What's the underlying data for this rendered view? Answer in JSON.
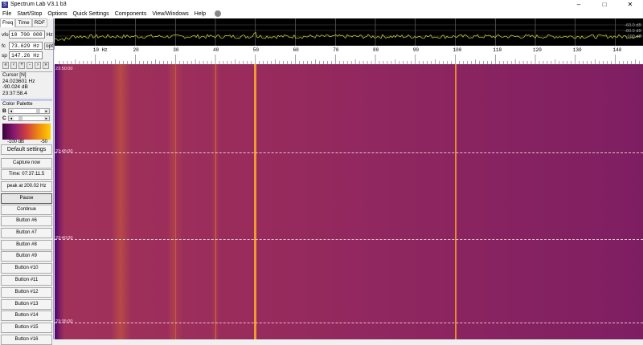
{
  "window": {
    "title": "Spectrum Lab V3.1 b3",
    "minimize": "–",
    "maximize": "□",
    "close": "✕"
  },
  "menu": [
    "File",
    "Start/Stop",
    "Options",
    "Quick Settings",
    "Components",
    "View/Windows",
    "Help"
  ],
  "left": {
    "tabs": [
      "Freq",
      "Time",
      "RDF"
    ],
    "vfo_label": "vfo",
    "vfo_value": "10 700 000",
    "vfo_unit": "Hz",
    "fc_label": "fc",
    "fc_value": "73.629 Hz",
    "fc_opt": "opt",
    "sp_label": "sp",
    "sp_value": "147.26 Hz",
    "small_buttons": [
      "«",
      "‹",
      "+",
      "-",
      "›",
      "»"
    ],
    "cursor": {
      "title": "Cursor [N]",
      "freq": "24.023601 Hz",
      "level": "-90.024 dB",
      "time": "23:37:58.4"
    },
    "palette": {
      "title": "Color Palette",
      "b": "B",
      "c": "C",
      "min": "-100 dB",
      "max": "-50"
    },
    "buttons": [
      "Default settings",
      "Capture now",
      "Time:  07:37:11.5",
      "peak at 200.02 Hz",
      "Pause",
      "Continue",
      "Button #6",
      "Button #7",
      "Button #8",
      "Button #9",
      "Button #10",
      "Button #11",
      "Button #12",
      "Button #13",
      "Button #14",
      "Button #15",
      "Button #16"
    ]
  },
  "spectrum": {
    "db_labels": [
      "-60.0 dB",
      "-80.0 dB",
      "-100 dB"
    ],
    "freq_ticks": [
      "10 Hz",
      "20",
      "30",
      "40",
      "50",
      "60",
      "70",
      "80",
      "90",
      "100",
      "110",
      "120",
      "130",
      "140"
    ]
  },
  "waterfall": {
    "time_labels": [
      "23:50:00",
      "23:45:00",
      "23:40:00",
      "23:35:00"
    ]
  },
  "colors": {
    "trace": "#d8d830",
    "line": "#f0a030"
  }
}
